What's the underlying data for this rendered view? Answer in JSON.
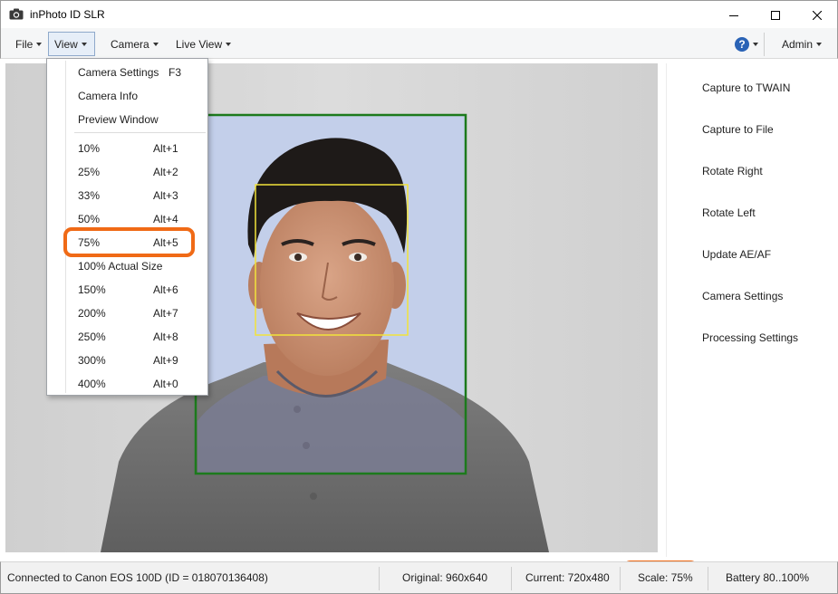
{
  "window": {
    "title": "inPhoto ID SLR"
  },
  "menubar": {
    "file": "File",
    "view": "View",
    "camera": "Camera",
    "live_view": "Live View",
    "help": "?",
    "admin": "Admin"
  },
  "view_menu": {
    "items": [
      {
        "label": "Camera Settings",
        "shortcut": "F3"
      },
      {
        "label": "Camera Info",
        "shortcut": ""
      },
      {
        "label": "Preview Window",
        "shortcut": ""
      },
      {
        "label": "10%",
        "shortcut": "Alt+1"
      },
      {
        "label": "25%",
        "shortcut": "Alt+2"
      },
      {
        "label": "33%",
        "shortcut": "Alt+3"
      },
      {
        "label": "50%",
        "shortcut": "Alt+4"
      },
      {
        "label": "75%",
        "shortcut": "Alt+5"
      },
      {
        "label": "100% Actual Size",
        "shortcut": ""
      },
      {
        "label": "150%",
        "shortcut": "Alt+6"
      },
      {
        "label": "200%",
        "shortcut": "Alt+7"
      },
      {
        "label": "250%",
        "shortcut": "Alt+8"
      },
      {
        "label": "300%",
        "shortcut": "Alt+9"
      },
      {
        "label": "400%",
        "shortcut": "Alt+0"
      }
    ],
    "highlighted": "75%"
  },
  "side_panel": {
    "buttons": [
      "Capture to TWAIN",
      "Capture to File",
      "Rotate Right",
      "Rotate Left",
      "Update AE/AF",
      "Camera Settings",
      "Processing Settings"
    ]
  },
  "status": {
    "connection": "Connected to Canon EOS 100D (ID = 018070136408)",
    "original": "Original: 960x640",
    "current": "Current: 720x480",
    "scale": "Scale: 75%",
    "battery": "Battery 80..100%"
  },
  "colors": {
    "highlight_ring": "#f06a16",
    "crop_frame": "#1c7a1c",
    "face_frame": "#f2e33a",
    "photo_background": "#c3cfea",
    "preview_background": "#d3d3d3"
  }
}
